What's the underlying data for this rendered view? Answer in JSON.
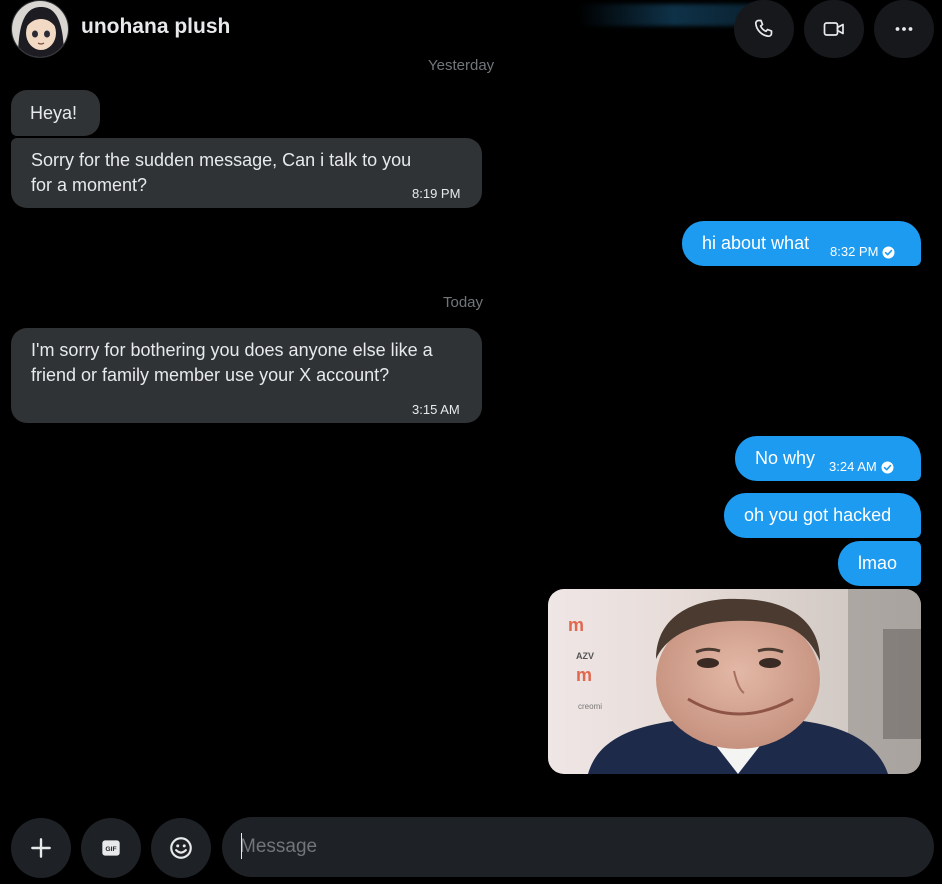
{
  "header": {
    "title": "unohana plush",
    "avatar_icon": "profile-avatar",
    "actions": [
      {
        "name": "voice-call",
        "icon": "phone-icon"
      },
      {
        "name": "video-call",
        "icon": "video-camera-icon"
      },
      {
        "name": "more-options",
        "icon": "more-icon"
      }
    ]
  },
  "dividers": {
    "yesterday": "Yesterday",
    "today": "Today"
  },
  "messages": {
    "m1": {
      "text": "Heya!"
    },
    "m2": {
      "line1": "Sorry for the sudden message, Can i talk to you",
      "line2": "for a moment?",
      "time": "8:19 PM"
    },
    "m3": {
      "text": "hi about what",
      "time": "8:32 PM",
      "status": "read"
    },
    "m4": {
      "line1": "I'm sorry for bothering you does anyone else like a",
      "line2": "friend or family member use your X account?",
      "time": "3:15 AM"
    },
    "m5": {
      "text": "No why",
      "time": "3:24 AM",
      "status": "read"
    },
    "m6": {
      "text": "oh you got hacked"
    },
    "m7": {
      "text": "lmao"
    },
    "m8": {
      "type": "image"
    }
  },
  "composer": {
    "placeholder": "Message",
    "buttons": [
      {
        "name": "add",
        "icon": "plus-icon"
      },
      {
        "name": "gif",
        "icon": "gif-icon",
        "label": "GIF"
      },
      {
        "name": "emoji",
        "icon": "emoji-icon"
      }
    ]
  },
  "colors": {
    "background": "#000000",
    "incoming_bubble": "#2f3336",
    "outgoing_bubble": "#1d9bf0",
    "muted_text": "#71767b"
  }
}
